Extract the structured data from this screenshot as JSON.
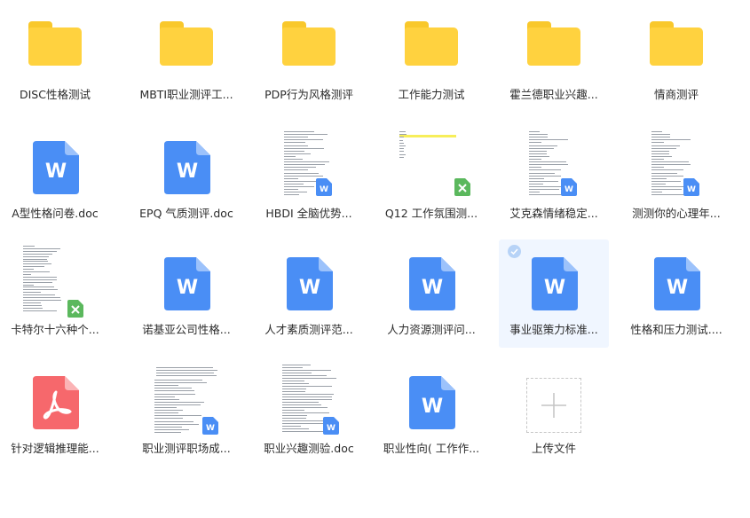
{
  "colors": {
    "folder": "#ffd23f",
    "folder_tab": "#f9c82b",
    "word": "#4a8ef5",
    "excel": "#5bb85d",
    "pdf": "#f6686c",
    "selected_bg": "#f0f6ff"
  },
  "items": [
    {
      "label": "DISC性格测试",
      "type": "folder",
      "icon": "folder-icon"
    },
    {
      "label": "MBTI职业测评工...",
      "type": "folder",
      "icon": "folder-icon"
    },
    {
      "label": "PDP行为风格测评",
      "type": "folder",
      "icon": "folder-icon"
    },
    {
      "label": "工作能力测试",
      "type": "folder",
      "icon": "folder-icon"
    },
    {
      "label": "霍兰德职业兴趣...",
      "type": "folder",
      "icon": "folder-icon"
    },
    {
      "label": "情商测评",
      "type": "folder",
      "icon": "folder-icon"
    },
    {
      "label": "A型性格问卷.doc",
      "type": "word",
      "icon": "word-doc-icon"
    },
    {
      "label": "EPQ 气质测评.doc",
      "type": "word",
      "icon": "word-doc-icon"
    },
    {
      "label": "HBDI 全脑优势...",
      "type": "thumb-word",
      "icon": "document-thumbnail"
    },
    {
      "label": "Q12 工作氛围测...",
      "type": "thumb-excel",
      "icon": "spreadsheet-thumbnail"
    },
    {
      "label": "艾克森情绪稳定...",
      "type": "thumb-word",
      "icon": "document-thumbnail"
    },
    {
      "label": "测测你的心理年...",
      "type": "thumb-word",
      "icon": "document-thumbnail"
    },
    {
      "label": "卡特尔十六种个...",
      "type": "thumb-excel2",
      "icon": "spreadsheet-thumbnail"
    },
    {
      "label": "诺基亚公司性格...",
      "type": "word",
      "icon": "word-doc-icon"
    },
    {
      "label": "人才素质测评范...",
      "type": "word",
      "icon": "word-doc-icon"
    },
    {
      "label": "人力资源测评问...",
      "type": "word",
      "icon": "word-doc-icon"
    },
    {
      "label": "事业驱策力标准...",
      "type": "word",
      "icon": "word-doc-icon",
      "selected": true
    },
    {
      "label": "性格和压力测试....",
      "type": "word",
      "icon": "word-doc-icon"
    },
    {
      "label": "针对逻辑推理能...",
      "type": "pdf",
      "icon": "pdf-icon"
    },
    {
      "label": "职业测评职场成...",
      "type": "thumb-word2",
      "icon": "document-thumbnail"
    },
    {
      "label": "职业兴趣测验.doc",
      "type": "thumb-word3",
      "icon": "document-thumbnail"
    },
    {
      "label": "职业性向( 工作作...",
      "type": "word",
      "icon": "word-doc-icon"
    },
    {
      "label": "上传文件",
      "type": "upload",
      "icon": "plus-icon"
    }
  ]
}
